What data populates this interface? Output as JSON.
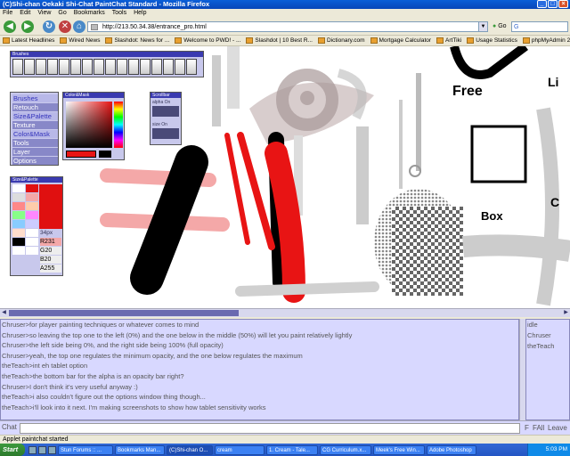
{
  "window": {
    "title": "(C)Shi-chan Oekaki Shi-Chat PaintChat Standard - Mozilla Firefox"
  },
  "menu": [
    "File",
    "Edit",
    "View",
    "Go",
    "Bookmarks",
    "Tools",
    "Help"
  ],
  "nav": {
    "url": "http://213.50.34.38/entrance_pro.html",
    "go_label": "Go",
    "search_placeholder": "G"
  },
  "bookmarks": [
    "Latest Headlines",
    "Wired News",
    "Slashdot: News for ...",
    "Welcome to PWD! - ...",
    "Slashdot | 10 Best R...",
    "Dictionary.com",
    "Mortgage Calculator",
    "ArtTiki",
    "Usage Statistics",
    "phpMyAdmin 2.4.0"
  ],
  "palettes": {
    "brushes_title": "Brushes",
    "menu_items": [
      "Brushes",
      "Retouch",
      "Size&Palette",
      "Texture",
      "Color&Mask",
      "Tools",
      "Layer",
      "Options"
    ],
    "color_title": "Color&Mask",
    "scrollbar_title": "Scrollbar",
    "alpha_label": "alpha On",
    "size_label": "size On",
    "swatch_title": "Size&Palette",
    "size_px": "34px",
    "rgba": [
      "R231",
      "G20",
      "B20",
      "A255"
    ],
    "colors": {
      "current": "#e81414",
      "red": "#e01010"
    }
  },
  "canvas_text": [
    "Free",
    "Box",
    "Li",
    "C"
  ],
  "chat": {
    "lines": [
      "Chruser>for player painting techniques or whatever comes to mind",
      "Chruser>so leaving the top one to the left (0%) and the one below in the middle (50%) will let you paint relatively lightly",
      "Chruser>the left side being 0%, and the right side being 100% (full opacity)",
      "Chruser>yeah, the top one regulates the minimum opacity, and the one below regulates the maximum",
      "theTeach>int eh tablet option",
      "theTeach>the bottom bar for the alpha is an opacity bar right?",
      "Chruser>I don't think it's very useful anyway :)",
      "theTeach>i also couldn't figure out the options window thing though...",
      "theTeach>i'll look into it next. I'm making screenshots to show how tablet sensitivity works"
    ],
    "users": [
      "idle",
      "Chruser",
      "theTeach"
    ],
    "input_label": "Chat",
    "buttons": [
      "F",
      "FAll",
      "Leave"
    ]
  },
  "status": "Applet paintchat started",
  "taskbar": {
    "start": "Start",
    "tasks": [
      "Stun Forums :: ...",
      "Bookmarks Man...",
      "(C)Shi-chan O...",
      "cream",
      "1. Cream - Tale...",
      "CG Curriculum.x...",
      "Meek's Free Win...",
      "Adobe Photoshop"
    ],
    "clock": "5:03 PM"
  }
}
